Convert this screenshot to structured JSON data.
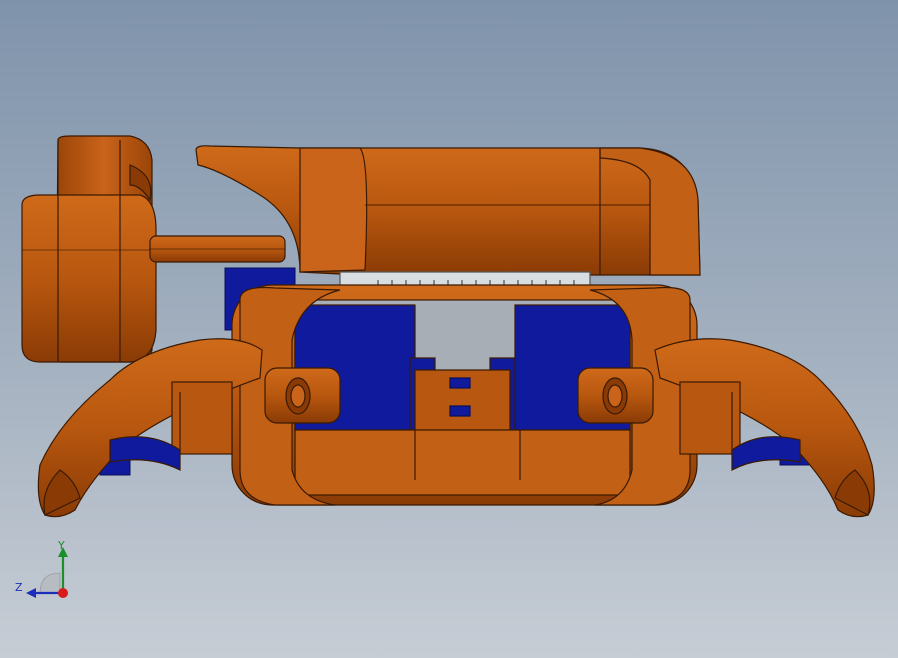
{
  "colors": {
    "background_top": "#7f93ab",
    "background_bottom": "#c7cdd5",
    "body_orange": "#b8570f",
    "body_orange_light": "#d5721e",
    "body_orange_dark": "#8a3b05",
    "edge": "#3a1a03",
    "motor_blue": "#0f1a9c",
    "motor_blue_dark": "#0a0f5a",
    "axis_x": "#d81b1b",
    "axis_y": "#1a8f2a",
    "axis_z": "#1d2fb8"
  },
  "triad": {
    "y_label": "Y",
    "z_label": "Z"
  },
  "icons": {
    "model": "robot-cad-model",
    "triad": "axis-triad-icon"
  }
}
